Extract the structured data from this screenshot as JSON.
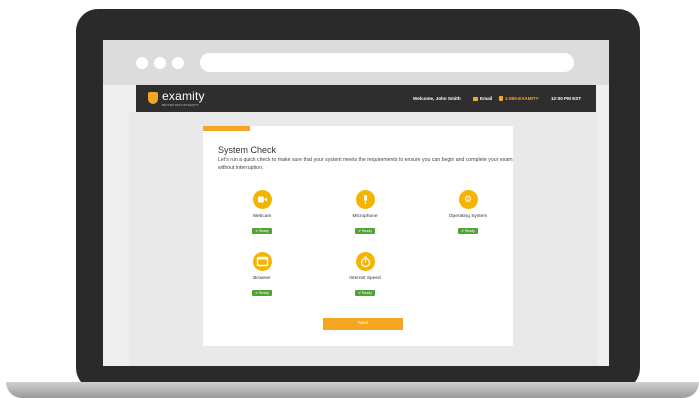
{
  "header": {
    "logo_text": "examity",
    "logo_tagline": "BETTER TEST INTEGRITY",
    "welcome": "Welcome, John Smith",
    "email_label": "Email",
    "phone": "1-855-EXAMITY",
    "time": "12:00 PM EST"
  },
  "system_check": {
    "title": "System Check",
    "description": "Let's run a quick check to make sure that your system meets the requirements to ensure you can begin and complete your exam without interruption.",
    "checks": [
      {
        "label": "Webcam",
        "status": "Ready",
        "icon": "camera-icon"
      },
      {
        "label": "Microphone",
        "status": "Ready",
        "icon": "microphone-icon"
      },
      {
        "label": "Operating System",
        "status": "Ready",
        "icon": "gear-icon"
      },
      {
        "label": "Browser",
        "status": "Ready",
        "icon": "browser-window-icon"
      },
      {
        "label": "Internet Speed",
        "status": "Ready",
        "icon": "stopwatch-icon"
      }
    ],
    "next_label": "Next"
  },
  "colors": {
    "accent": "#f5a623",
    "ready_badge": "#52a337",
    "appbar": "#2e2e2e"
  }
}
